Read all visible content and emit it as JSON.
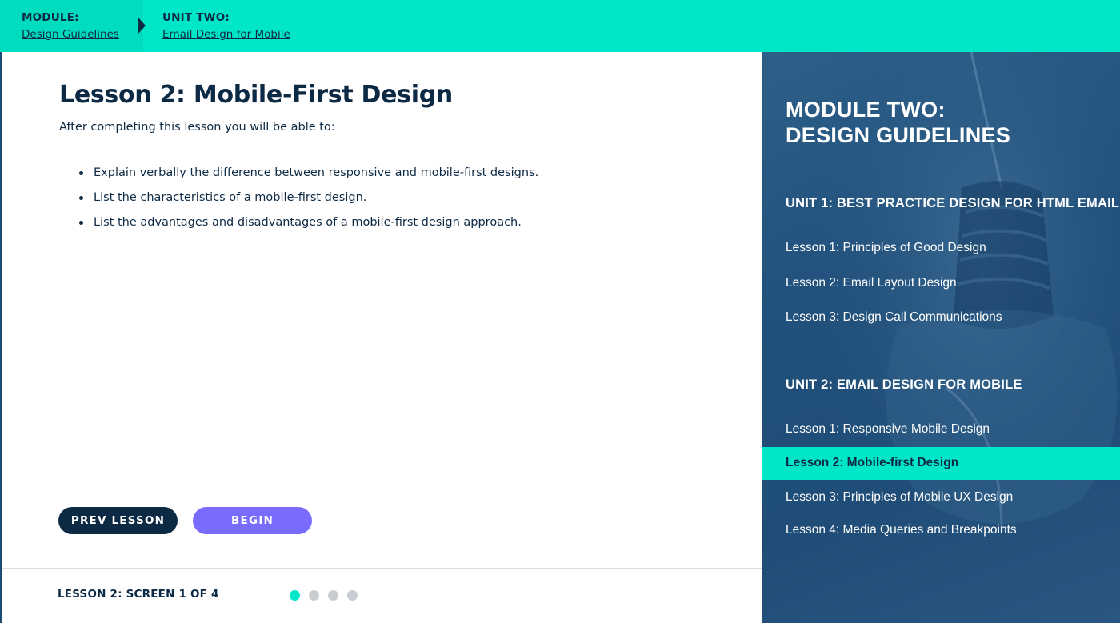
{
  "breadcrumb": {
    "module_label": "MODULE:",
    "module_link": "Design Guidelines",
    "unit_label": "UNIT TWO:",
    "unit_link": "Email Design for Mobile"
  },
  "lesson": {
    "title": "Lesson 2: Mobile-First Design",
    "intro": "After completing this lesson you will be able to:",
    "objectives": [
      "Explain verbally the difference between responsive and mobile-first designs.",
      "List the characteristics of a mobile-first design.",
      "List the advantages and disadvantages of a mobile-first design approach."
    ]
  },
  "buttons": {
    "prev": "PREV LESSON",
    "begin": "BEGIN"
  },
  "footer": {
    "screen_label": "LESSON 2: SCREEN 1 OF 4",
    "current_screen": 1,
    "total_screens": 4
  },
  "sidebar": {
    "module_title_line1": "MODULE TWO:",
    "module_title_line2": "DESIGN GUIDELINES",
    "units": [
      {
        "heading": "UNIT 1: BEST PRACTICE DESIGN FOR HTML EMAIL",
        "lessons": [
          "Lesson 1: Principles of Good Design",
          "Lesson 2: Email Layout Design",
          "Lesson 3: Design Call Communications"
        ]
      },
      {
        "heading": "UNIT 2: EMAIL DESIGN FOR MOBILE",
        "lessons": [
          "Lesson 1: Responsive Mobile Design",
          "Lesson 2: Mobile-first Design",
          "Lesson 3: Principles of Mobile UX Design",
          "Lesson 4: Media Queries and Breakpoints"
        ]
      }
    ]
  },
  "colors": {
    "accent": "#00e6c9",
    "navy": "#0d2a45",
    "begin_button": "#7a6bff",
    "sidebar_bg": "#1f4d77",
    "dot_inactive": "#c9cdd1"
  }
}
